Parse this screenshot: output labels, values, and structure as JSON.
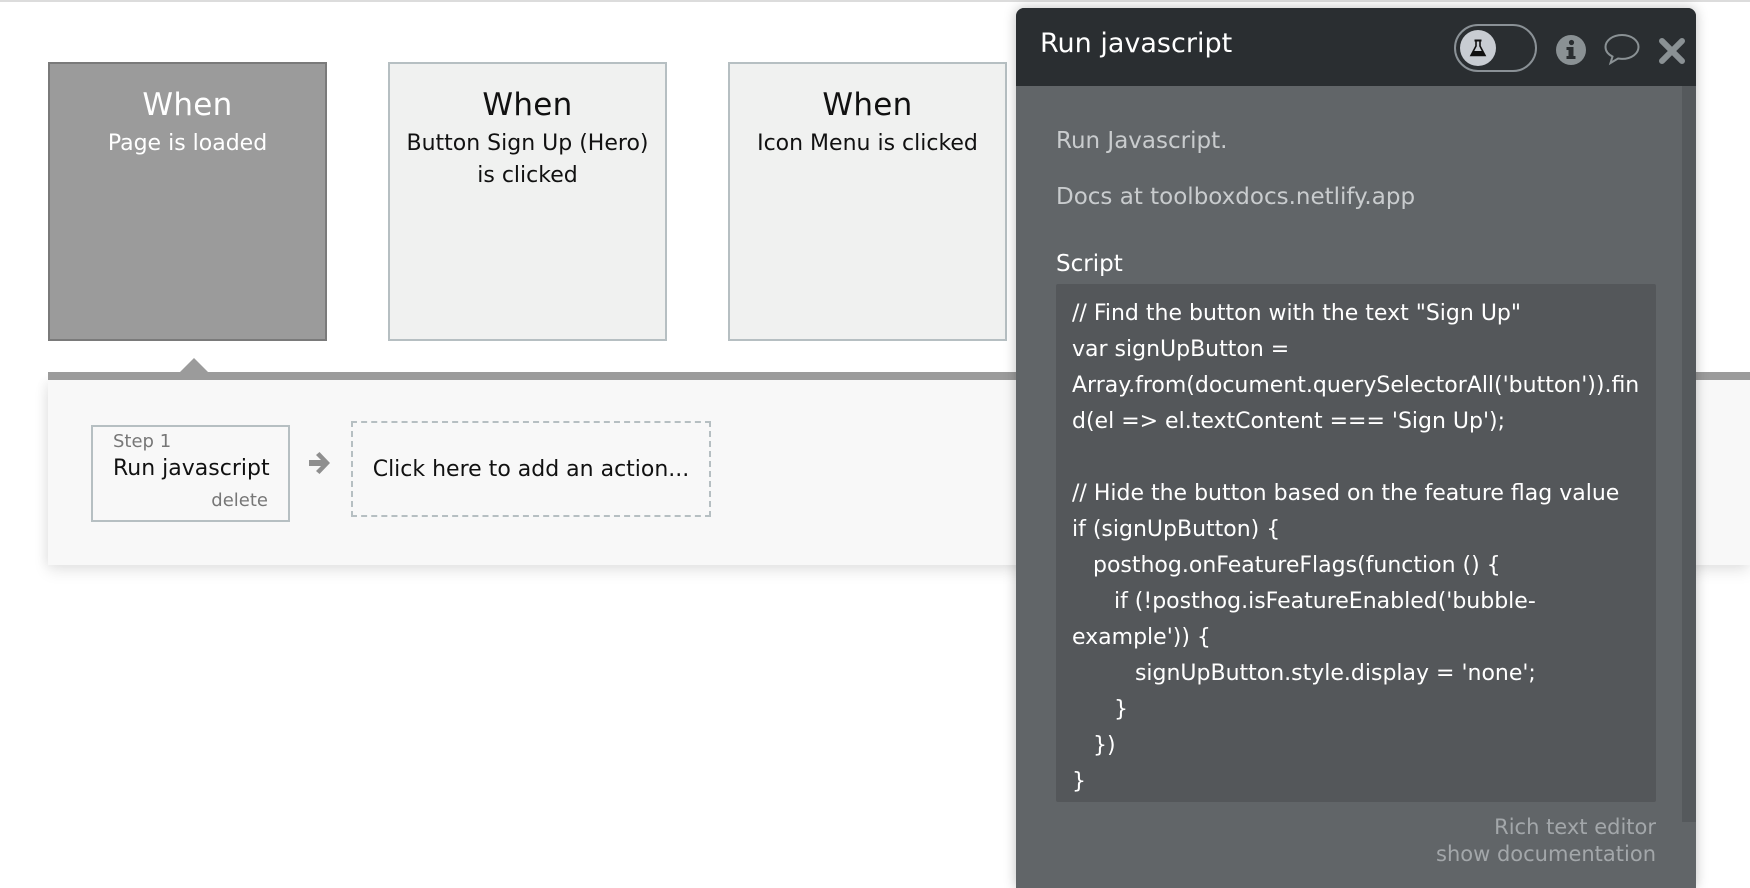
{
  "events": [
    {
      "when": "When",
      "trigger": "Page is loaded",
      "selected": true
    },
    {
      "when": "When",
      "trigger": "Button Sign Up (Hero) is clicked",
      "selected": false
    },
    {
      "when": "When",
      "trigger": "Icon Menu is clicked",
      "selected": false
    }
  ],
  "steps": {
    "items": [
      {
        "number": "Step 1",
        "action": "Run javascript",
        "delete_label": "delete"
      }
    ],
    "add_action_label": "Click here to add an action..."
  },
  "panel": {
    "title": "Run javascript",
    "icons": {
      "toggle": "flask-icon",
      "info": "info-icon",
      "comment": "speech-bubble-icon",
      "close": "close-icon"
    },
    "description": "Run Javascript.",
    "docs": "Docs at toolboxdocs.netlify.app",
    "script_label": "Script",
    "script_lines": [
      "// Find the button with the text \"Sign Up\"",
      "var signUpButton =",
      "Array.from(document.querySelectorAll('button')).fin",
      "d(el => el.textContent === 'Sign Up');",
      "",
      "// Hide the button based on the feature flag value",
      "if (signUpButton) {",
      "   posthog.onFeatureFlags(function () {",
      "      if (!posthog.isFeatureEnabled('bubble-",
      "example')) {",
      "         signUpButton.style.display = 'none';",
      "      }",
      "   })",
      "}"
    ],
    "rich_text_editor_label": "Rich text editor",
    "show_documentation_label": "show documentation"
  },
  "colors": {
    "panel_header": "#2a2e31",
    "panel_body": "#616568",
    "code_bg": "#54575a",
    "selected_event": "#9b9b9b",
    "event_bg": "#f0f1f0"
  }
}
